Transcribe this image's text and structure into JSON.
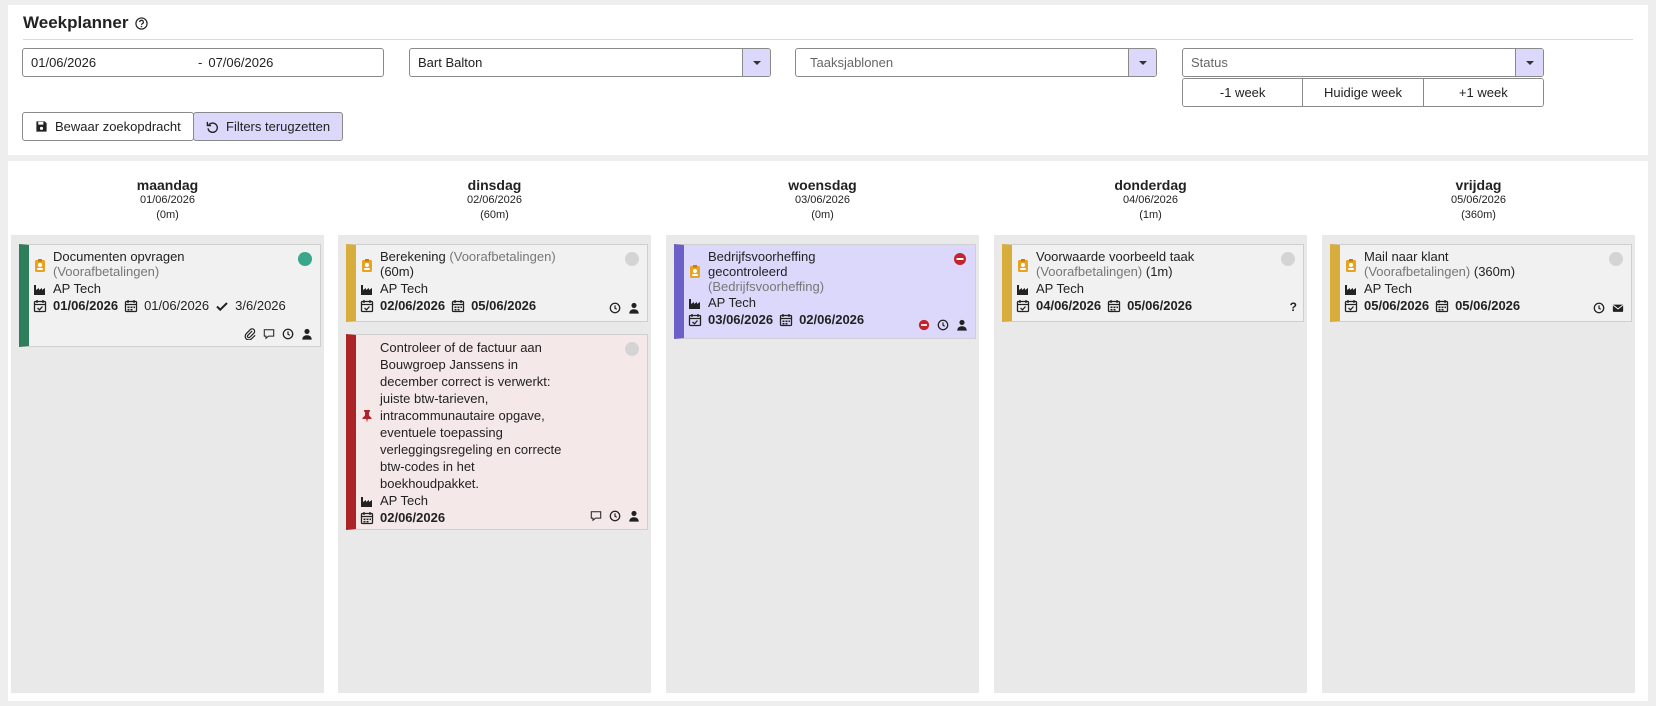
{
  "header": {
    "title": "Weekplanner"
  },
  "filters": {
    "date_from": "01/06/2026",
    "date_sep": "-",
    "date_to": "07/06/2026",
    "employee": "Bart Balton",
    "templates_placeholder": "Taaksjablonen",
    "status_placeholder": "Status",
    "prev_week": "-1 week",
    "current_week": "Huidige week",
    "next_week": "+1 week",
    "save_search": "Bewaar zoekopdracht",
    "reset_filters": "Filters terugzetten"
  },
  "days": [
    {
      "name": "maandag",
      "date": "01/06/2026",
      "total": "(0m)"
    },
    {
      "name": "dinsdag",
      "date": "02/06/2026",
      "total": "(60m)"
    },
    {
      "name": "woensdag",
      "date": "03/06/2026",
      "total": "(0m)"
    },
    {
      "name": "donderdag",
      "date": "04/06/2026",
      "total": "(1m)"
    },
    {
      "name": "vrijdag",
      "date": "05/06/2026",
      "total": "(360m)"
    }
  ],
  "tasks": {
    "mon1": {
      "title": "Documenten opvragen",
      "category": "(Voorafbetalingen)",
      "client": "AP Tech",
      "due": "01/06/2026",
      "planned": "01/06/2026",
      "done": "3/6/2026"
    },
    "tue1": {
      "title": "Berekening",
      "category": "(Voorafbetalingen)",
      "duration": "(60m)",
      "client": "AP Tech",
      "due": "02/06/2026",
      "planned": "05/06/2026"
    },
    "tue2": {
      "lines": [
        "Controleer of de factuur aan",
        "Bouwgroep Janssens in",
        "december correct is verwerkt:",
        "juiste btw-tarieven,",
        "intracommunautaire opgave,",
        "eventuele toepassing",
        "verleggingsregeling en correcte",
        "btw-codes in het",
        "boekhoudpakket."
      ],
      "client": "AP Tech",
      "planned": "02/06/2026"
    },
    "wed1": {
      "title1": "Bedrijfsvoorheffing",
      "title2": "gecontroleerd",
      "category": "(Bedrijfsvoorheffing)",
      "client": "AP Tech",
      "due": "03/06/2026",
      "planned": "02/06/2026"
    },
    "thu1": {
      "title": "Voorwaarde voorbeeld taak",
      "category": "(Voorafbetalingen)",
      "duration": "(1m)",
      "client": "AP Tech",
      "due": "04/06/2026",
      "planned": "05/06/2026",
      "flag": "?"
    },
    "fri1": {
      "title": "Mail naar klant",
      "category": "(Voorafbetalingen)",
      "duration": "(360m)",
      "client": "AP Tech",
      "due": "05/06/2026",
      "planned": "05/06/2026"
    }
  },
  "colors": {
    "accent": "#dcd8fb",
    "green": "#2e7d5b",
    "yellow": "#d9ad3c",
    "red": "#ab2327",
    "purple": "#6c5fc7"
  }
}
